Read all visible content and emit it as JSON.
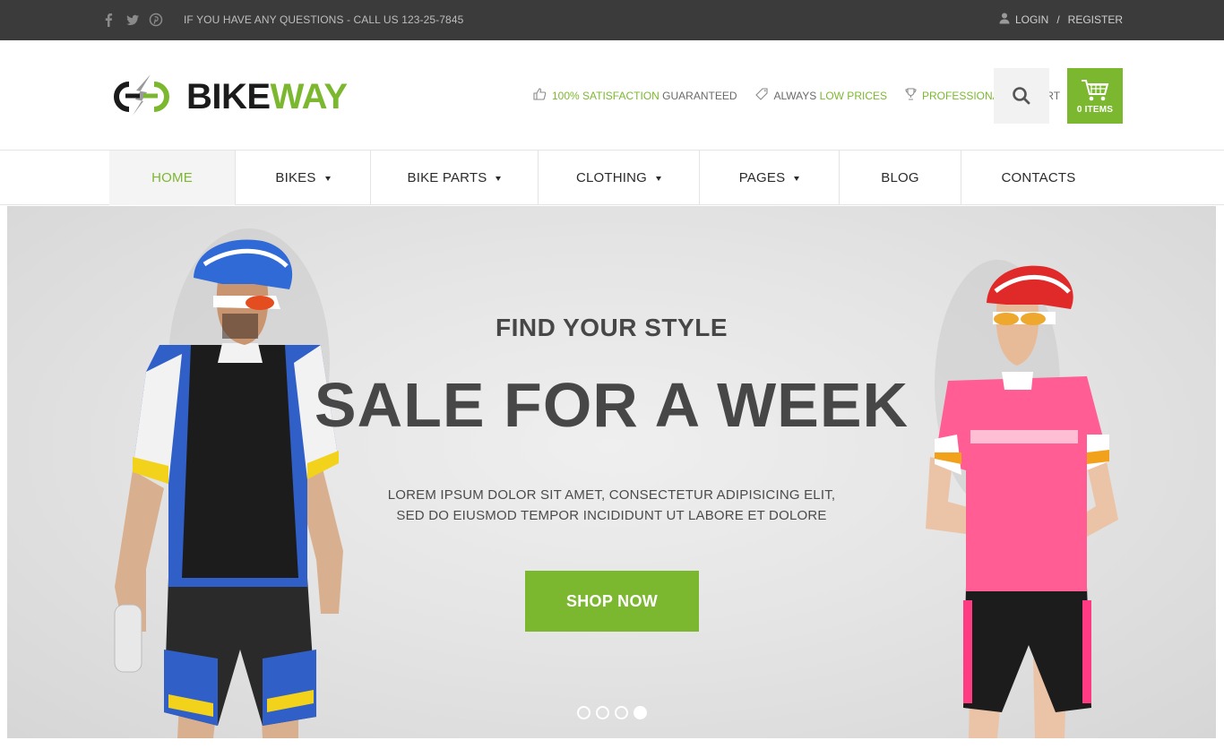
{
  "topbar": {
    "contact_text": "IF YOU HAVE ANY QUESTIONS - CALL US 123-25-7845",
    "login_label": "LOGIN",
    "separator": "/",
    "register_label": "REGISTER",
    "social_icons": [
      "facebook-icon",
      "twitter-icon",
      "pinterest-icon"
    ]
  },
  "header": {
    "logo_text_dark": "BIKE",
    "logo_text_green": "WAY",
    "features": [
      {
        "icon": "thumbs-up-icon",
        "highlight": "100% SATISFACTION",
        "rest": "GUARANTEED",
        "highlight_first": true
      },
      {
        "icon": "tag-icon",
        "prefix": "ALWAYS",
        "highlight": "LOW PRICES"
      },
      {
        "icon": "trophy-icon",
        "highlight": "PROFESSIONAL",
        "rest": "SUPPORT",
        "highlight_first": true
      }
    ],
    "cart_label": "0 ITEMS"
  },
  "nav": {
    "items": [
      {
        "label": "HOME",
        "dropdown": false,
        "active": true
      },
      {
        "label": "BIKES",
        "dropdown": true
      },
      {
        "label": "BIKE PARTS",
        "dropdown": true
      },
      {
        "label": "CLOTHING",
        "dropdown": true
      },
      {
        "label": "PAGES",
        "dropdown": true
      },
      {
        "label": "BLOG",
        "dropdown": false
      },
      {
        "label": "CONTACTS",
        "dropdown": false
      }
    ]
  },
  "hero": {
    "kicker": "FIND YOUR STYLE",
    "headline": "SALE FOR A WEEK",
    "sub_line1": "LOREM IPSUM DOLOR SIT AMET, CONSECTETUR ADIPISICING ELIT,",
    "sub_line2": "SED DO EIUSMOD TEMPOR INCIDIDUNT UT LABORE ET DOLORE",
    "cta_label": "SHOP NOW",
    "slide_count": 4,
    "active_slide": 4
  },
  "colors": {
    "accent": "#7cb82f",
    "topbar_bg": "#3b3b3b",
    "text_dark": "#474747"
  }
}
